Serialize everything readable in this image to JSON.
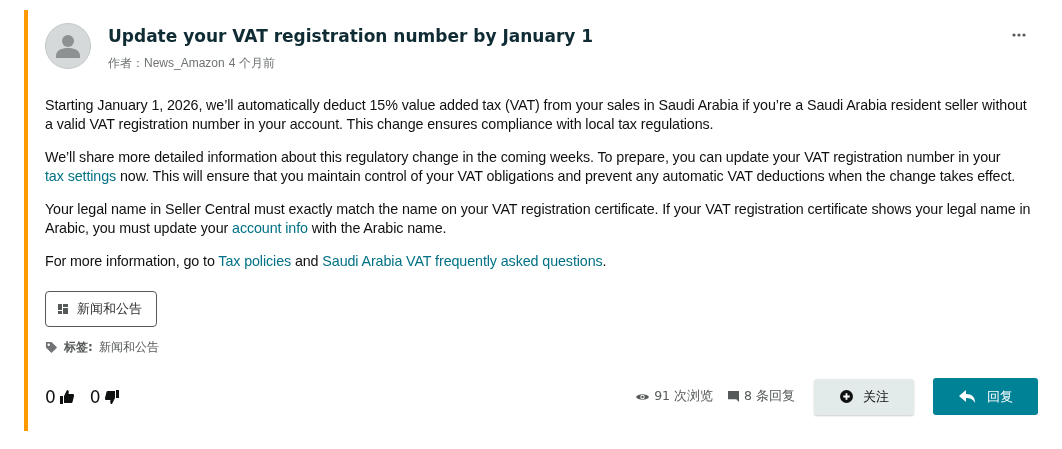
{
  "post": {
    "title": "Update your VAT registration number by January 1",
    "author_prefix": "作者：",
    "author": "News_Amazon",
    "time": "4 个月前"
  },
  "paragraphs": [
    [
      {
        "kind": "text",
        "text": "Starting January 1, 2026, we’ll automatically deduct 15% value added tax (VAT) from your sales in Saudi Arabia if you’re a Saudi Arabia resident seller without a valid VAT registration number in your account. This change ensures compliance with local tax regulations."
      }
    ],
    [
      {
        "kind": "text",
        "text": "We’ll share more detailed information about this regulatory change in the coming weeks. To prepare, you can update your VAT registration number in your "
      },
      {
        "kind": "link",
        "text": "tax settings"
      },
      {
        "kind": "text",
        "text": " now. This will ensure that you maintain control of your VAT obligations and prevent any automatic VAT deductions when the change takes effect."
      }
    ],
    [
      {
        "kind": "text",
        "text": "Your legal name in Seller Central must exactly match the name on your VAT registration certificate. If your VAT registration certificate shows your legal name in Arabic, you must update your "
      },
      {
        "kind": "link",
        "text": "account info"
      },
      {
        "kind": "text",
        "text": " with the Arabic name."
      }
    ],
    [
      {
        "kind": "text",
        "text": "For more information, go to "
      },
      {
        "kind": "link",
        "text": "Tax policies"
      },
      {
        "kind": "text",
        "text": " and "
      },
      {
        "kind": "link",
        "text": "Saudi Arabia VAT frequently asked questions"
      },
      {
        "kind": "text",
        "text": "."
      }
    ]
  ],
  "category_button": "新闻和公告",
  "tags": {
    "label": "标签:",
    "value": "新闻和公告"
  },
  "votes": {
    "up": "0",
    "down": "0"
  },
  "stats": {
    "views": "91 次浏览",
    "replies": "8 条回复"
  },
  "buttons": {
    "follow": "关注",
    "reply": "回复"
  }
}
